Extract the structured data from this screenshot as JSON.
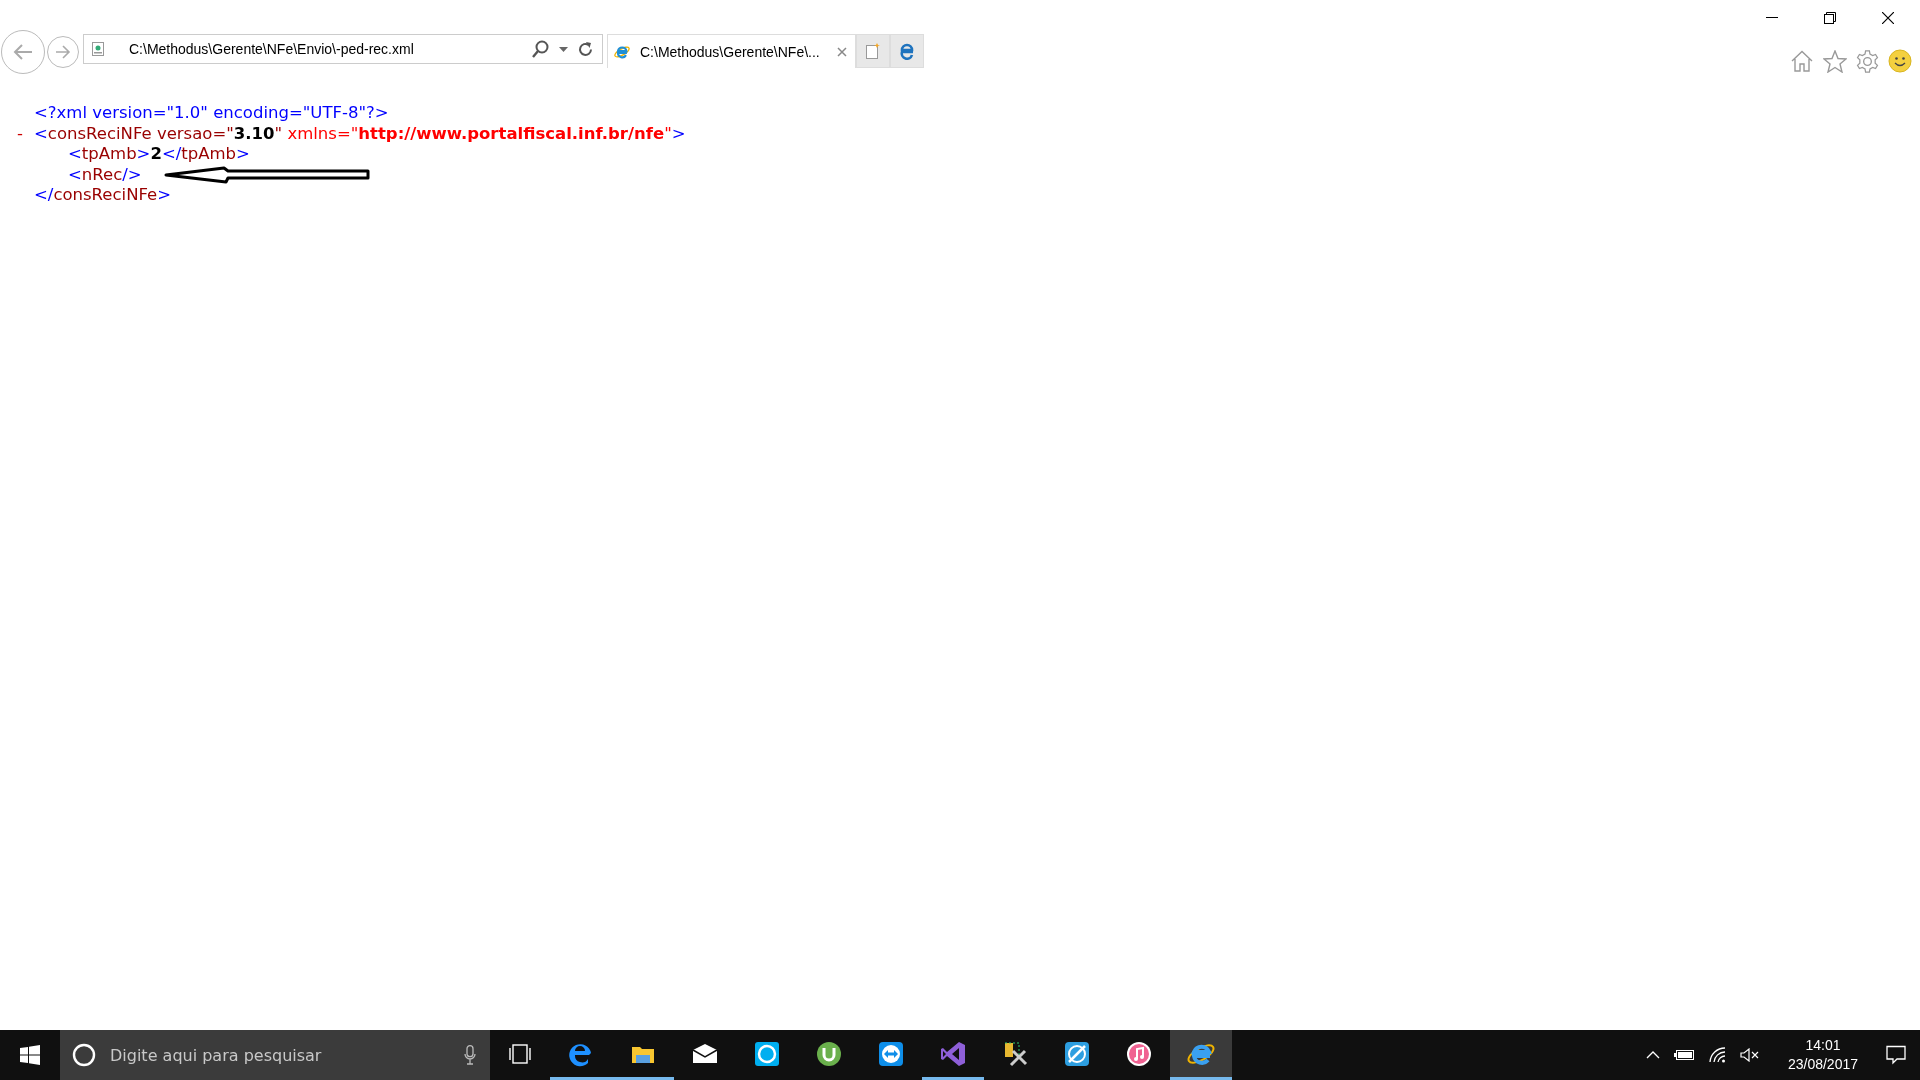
{
  "address_bar": {
    "value": "C:\\Methodus\\Gerente\\NFe\\Envio\\-ped-rec.xml"
  },
  "tabs": [
    {
      "label": "C:\\Methodus\\Gerente\\NFe\\...",
      "selected": true
    }
  ],
  "xml_lines": [
    {
      "segments": [
        {
          "kind": "punct",
          "text": "<?xml version=\"1.0\" encoding=\"UTF-8\"?>"
        }
      ]
    },
    {
      "toggle": "-",
      "segments": [
        {
          "kind": "punct",
          "text": "<"
        },
        {
          "kind": "name",
          "text": "consReciNFe"
        },
        {
          "kind": "attr",
          "text": " versao=\""
        },
        {
          "kind": "value",
          "text": "3.10"
        },
        {
          "kind": "attr",
          "text": "\""
        },
        {
          "kind": "ns-attr",
          "text": " xmlns=\""
        },
        {
          "kind": "ns-value",
          "text": "http://www.portalfiscal.inf.br/nfe"
        },
        {
          "kind": "ns-attr",
          "text": "\""
        },
        {
          "kind": "punct",
          "text": ">"
        }
      ],
      "children": [
        {
          "segments": [
            {
              "kind": "punct",
              "text": "<"
            },
            {
              "kind": "name",
              "text": "tpAmb"
            },
            {
              "kind": "punct",
              "text": ">"
            },
            {
              "kind": "value",
              "text": "2"
            },
            {
              "kind": "punct",
              "text": "</"
            },
            {
              "kind": "name",
              "text": "tpAmb"
            },
            {
              "kind": "punct",
              "text": ">"
            }
          ]
        },
        {
          "arrow": true,
          "segments": [
            {
              "kind": "punct",
              "text": "<"
            },
            {
              "kind": "name",
              "text": "nRec"
            },
            {
              "kind": "punct",
              "text": "/>"
            }
          ]
        }
      ],
      "closing": [
        {
          "kind": "punct",
          "text": "</"
        },
        {
          "kind": "name",
          "text": "consReciNFe"
        },
        {
          "kind": "punct",
          "text": ">"
        }
      ]
    }
  ],
  "taskbar": {
    "search": {
      "placeholder": "Digite aqui para pesquisar"
    },
    "apps": [
      {
        "kind": "edge",
        "running": true,
        "selected": false
      },
      {
        "kind": "folder",
        "running": true,
        "selected": false
      },
      {
        "kind": "mail",
        "running": false,
        "selected": false
      },
      {
        "kind": "skype",
        "running": false,
        "selected": false
      },
      {
        "kind": "torrent",
        "running": false,
        "selected": false
      },
      {
        "kind": "remote",
        "running": false,
        "selected": false
      },
      {
        "kind": "studio",
        "running": true,
        "selected": false
      },
      {
        "kind": "tools",
        "running": false,
        "selected": false
      },
      {
        "kind": "pen",
        "running": false,
        "selected": false
      },
      {
        "kind": "music",
        "running": false,
        "selected": false
      },
      {
        "kind": "ie",
        "running": true,
        "selected": true
      }
    ],
    "clock": {
      "time": "14:01",
      "date": "23/08/2017"
    }
  }
}
